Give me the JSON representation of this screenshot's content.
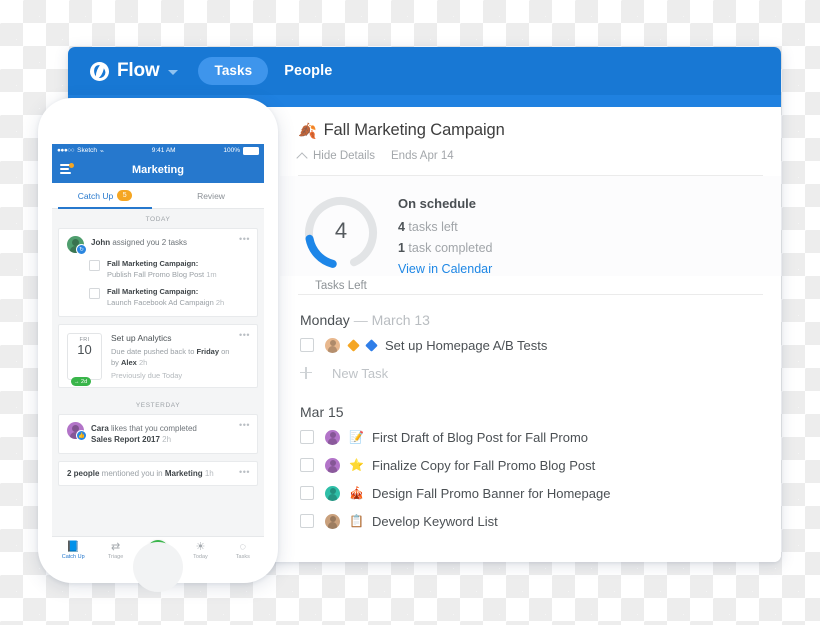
{
  "app": {
    "brand": "Flow",
    "brand_caret_icon": "chevron-down-icon",
    "nav": {
      "tasks_tab": "Tasks",
      "people_tab": "People"
    },
    "accent_blue": "#1878d4",
    "pill_blue": "#3e95ec"
  },
  "project": {
    "emoji": "🍂",
    "title": "Fall Marketing Campaign",
    "hide_details": "Hide Details",
    "ends": "Ends Apr 14",
    "chevron_icon": "chevron-up-icon"
  },
  "summary": {
    "count": "4",
    "count_label": "Tasks Left",
    "status": "On schedule",
    "tasks_left_num": "4",
    "tasks_left_text": " tasks left",
    "completed_num": "1",
    "completed_text": " task completed",
    "calendar_link": "View in Calendar",
    "donut_percent": 20,
    "donut_color": "#1d86e8",
    "donut_track": "#e2e4e6"
  },
  "groups": [
    {
      "day": "Monday",
      "dash": " — ",
      "date": "March 13",
      "tasks": [
        {
          "text": "Set up Homepage A/B Tests",
          "avatar_class": "av-a",
          "diamonds": [
            "#f5a623",
            "#2f7ee8"
          ],
          "icon": ""
        }
      ],
      "new_task": "New Task",
      "show_new_task": true
    },
    {
      "day": "Mar 15",
      "dash": "",
      "date": "",
      "show_new_task": false,
      "tasks": [
        {
          "text": "First Draft of Blog Post for Fall Promo",
          "avatar_class": "av-b",
          "diamonds": [],
          "icon": "📝"
        },
        {
          "text": "Finalize Copy for Fall Promo Blog Post",
          "avatar_class": "av-b",
          "diamonds": [],
          "icon": "⭐"
        },
        {
          "text": "Design Fall Promo Banner for Homepage",
          "avatar_class": "av-c",
          "diamonds": [],
          "icon": "🎪"
        },
        {
          "text": "Develop Keyword List",
          "avatar_class": "av-d",
          "diamonds": [],
          "icon": "📋"
        }
      ]
    }
  ],
  "phone": {
    "status_bar": {
      "dots": "●●●○○",
      "carrier": "Sketch",
      "wifi_icon": "wifi-icon",
      "wifi": "⌁",
      "time": "9:41 AM",
      "battery": "100%"
    },
    "nav": {
      "menu_icon": "hamburger-menu-icon",
      "title": "Marketing"
    },
    "tabs": {
      "catch_up": "Catch Up",
      "catch_up_badge": "5",
      "review": "Review"
    },
    "sections": [
      {
        "label": "TODAY"
      },
      {
        "label": "YESTERDAY"
      }
    ],
    "cards": {
      "john": {
        "actor": "John",
        "action": " assigned you 2 tasks",
        "subtasks": [
          {
            "project": "Fall Marketing Campaign:",
            "detail": "Publish Fall Promo Blog Post",
            "time": "1m"
          },
          {
            "project": "Fall Marketing Campaign:",
            "detail": "Launch Facebook Ad Campaign",
            "time": "2h"
          }
        ],
        "dots": "•••",
        "badge_icon": "assign-icon"
      },
      "analytics": {
        "dow": "FRI",
        "day": "10",
        "pill": "→ 2d",
        "title": "Set up Analytics",
        "line1_a": "Due date pushed back to ",
        "line1_b": "Friday",
        "line1_c": " on",
        "line2_a": "by ",
        "line2_b": "Alex",
        "line2_time": "2h",
        "previous": "Previously due Today",
        "dots": "•••"
      },
      "cara": {
        "actor": "Cara",
        "action": " likes that you completed",
        "object": "Sales Report 2017",
        "time": "2h",
        "dots": "•••",
        "badge_icon": "thumbs-up-icon"
      },
      "mention": {
        "prefix": "2 people",
        "middle": " mentioned you in ",
        "target": "Marketing",
        "time": "1h",
        "dots": "•••"
      }
    },
    "tabbar": [
      {
        "label": "Catch Up",
        "icon": "📘",
        "icon_name": "catch-up-icon",
        "active": true
      },
      {
        "label": "Triage",
        "icon": "⇄",
        "icon_name": "triage-icon",
        "active": false
      },
      {
        "label": "",
        "icon": "+",
        "icon_name": "add-fab-icon",
        "active": false
      },
      {
        "label": "Today",
        "icon": "☀",
        "icon_name": "today-sun-icon",
        "active": false
      },
      {
        "label": "Tasks",
        "icon": "◌",
        "icon_name": "tasks-check-icon",
        "active": false
      }
    ]
  }
}
